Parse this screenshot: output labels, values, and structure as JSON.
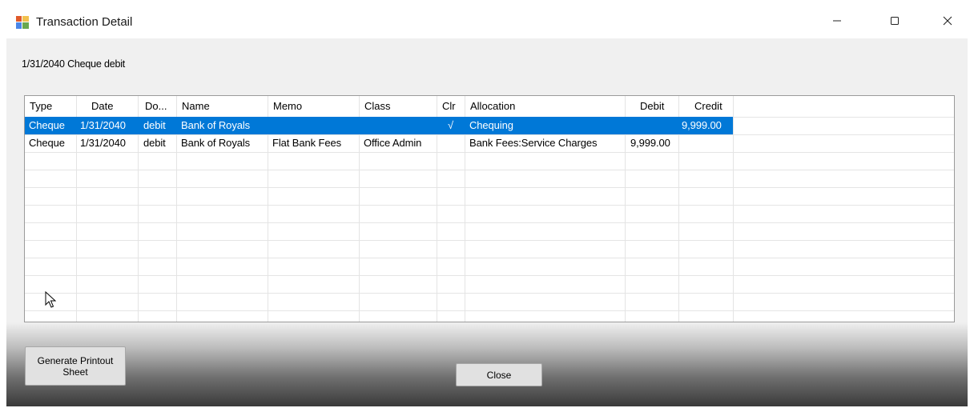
{
  "window": {
    "title": "Transaction Detail"
  },
  "header": {
    "subtitle": "1/31/2040 Cheque debit"
  },
  "grid": {
    "columns": [
      "Type",
      "Date",
      "Do...",
      "Name",
      "Memo",
      "Class",
      "Clr",
      "Allocation",
      "Debit",
      "Credit"
    ],
    "rows": [
      {
        "selected": true,
        "cells": [
          "Cheque",
          "1/31/2040",
          "debit",
          "Bank of Royals",
          "",
          "",
          "√",
          "Chequing",
          "",
          "9,999.00"
        ]
      },
      {
        "selected": false,
        "cells": [
          "Cheque",
          "1/31/2040",
          "debit",
          "Bank of Royals",
          "Flat Bank Fees",
          "Office Admin",
          "",
          "Bank Fees:Service Charges",
          "9,999.00",
          ""
        ]
      }
    ]
  },
  "buttons": {
    "generate": "Generate Printout Sheet",
    "close": "Close"
  },
  "colors": {
    "selection": "#0078d7",
    "grid_border": "#9a9a9a"
  },
  "icons": {
    "app": "app-window-icon",
    "minimize": "minimize-icon",
    "maximize": "maximize-icon",
    "close": "close-icon",
    "cursor": "mouse-pointer-icon"
  }
}
